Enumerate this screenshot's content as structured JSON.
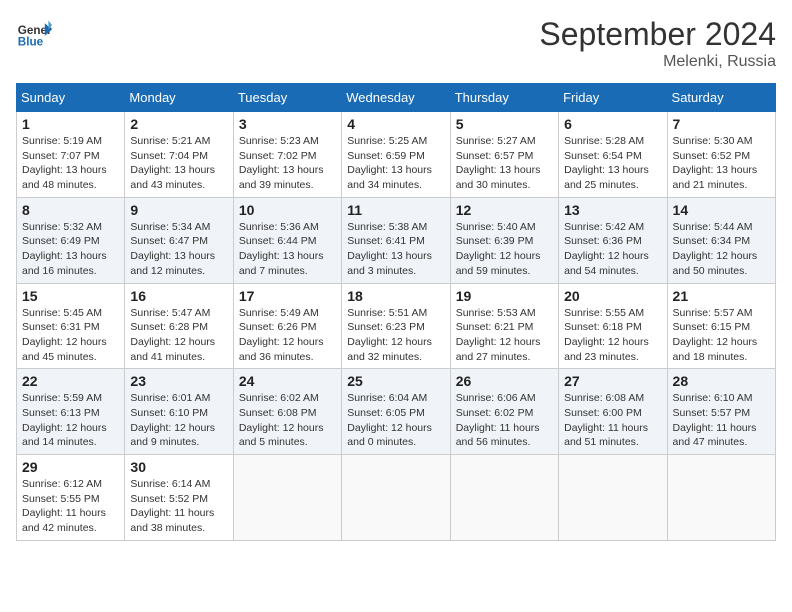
{
  "header": {
    "logo_line1": "General",
    "logo_line2": "Blue",
    "month": "September 2024",
    "location": "Melenki, Russia"
  },
  "weekdays": [
    "Sunday",
    "Monday",
    "Tuesday",
    "Wednesday",
    "Thursday",
    "Friday",
    "Saturday"
  ],
  "weeks": [
    [
      {
        "day": "1",
        "info": "Sunrise: 5:19 AM\nSunset: 7:07 PM\nDaylight: 13 hours\nand 48 minutes."
      },
      {
        "day": "2",
        "info": "Sunrise: 5:21 AM\nSunset: 7:04 PM\nDaylight: 13 hours\nand 43 minutes."
      },
      {
        "day": "3",
        "info": "Sunrise: 5:23 AM\nSunset: 7:02 PM\nDaylight: 13 hours\nand 39 minutes."
      },
      {
        "day": "4",
        "info": "Sunrise: 5:25 AM\nSunset: 6:59 PM\nDaylight: 13 hours\nand 34 minutes."
      },
      {
        "day": "5",
        "info": "Sunrise: 5:27 AM\nSunset: 6:57 PM\nDaylight: 13 hours\nand 30 minutes."
      },
      {
        "day": "6",
        "info": "Sunrise: 5:28 AM\nSunset: 6:54 PM\nDaylight: 13 hours\nand 25 minutes."
      },
      {
        "day": "7",
        "info": "Sunrise: 5:30 AM\nSunset: 6:52 PM\nDaylight: 13 hours\nand 21 minutes."
      }
    ],
    [
      {
        "day": "8",
        "info": "Sunrise: 5:32 AM\nSunset: 6:49 PM\nDaylight: 13 hours\nand 16 minutes."
      },
      {
        "day": "9",
        "info": "Sunrise: 5:34 AM\nSunset: 6:47 PM\nDaylight: 13 hours\nand 12 minutes."
      },
      {
        "day": "10",
        "info": "Sunrise: 5:36 AM\nSunset: 6:44 PM\nDaylight: 13 hours\nand 7 minutes."
      },
      {
        "day": "11",
        "info": "Sunrise: 5:38 AM\nSunset: 6:41 PM\nDaylight: 13 hours\nand 3 minutes."
      },
      {
        "day": "12",
        "info": "Sunrise: 5:40 AM\nSunset: 6:39 PM\nDaylight: 12 hours\nand 59 minutes."
      },
      {
        "day": "13",
        "info": "Sunrise: 5:42 AM\nSunset: 6:36 PM\nDaylight: 12 hours\nand 54 minutes."
      },
      {
        "day": "14",
        "info": "Sunrise: 5:44 AM\nSunset: 6:34 PM\nDaylight: 12 hours\nand 50 minutes."
      }
    ],
    [
      {
        "day": "15",
        "info": "Sunrise: 5:45 AM\nSunset: 6:31 PM\nDaylight: 12 hours\nand 45 minutes."
      },
      {
        "day": "16",
        "info": "Sunrise: 5:47 AM\nSunset: 6:28 PM\nDaylight: 12 hours\nand 41 minutes."
      },
      {
        "day": "17",
        "info": "Sunrise: 5:49 AM\nSunset: 6:26 PM\nDaylight: 12 hours\nand 36 minutes."
      },
      {
        "day": "18",
        "info": "Sunrise: 5:51 AM\nSunset: 6:23 PM\nDaylight: 12 hours\nand 32 minutes."
      },
      {
        "day": "19",
        "info": "Sunrise: 5:53 AM\nSunset: 6:21 PM\nDaylight: 12 hours\nand 27 minutes."
      },
      {
        "day": "20",
        "info": "Sunrise: 5:55 AM\nSunset: 6:18 PM\nDaylight: 12 hours\nand 23 minutes."
      },
      {
        "day": "21",
        "info": "Sunrise: 5:57 AM\nSunset: 6:15 PM\nDaylight: 12 hours\nand 18 minutes."
      }
    ],
    [
      {
        "day": "22",
        "info": "Sunrise: 5:59 AM\nSunset: 6:13 PM\nDaylight: 12 hours\nand 14 minutes."
      },
      {
        "day": "23",
        "info": "Sunrise: 6:01 AM\nSunset: 6:10 PM\nDaylight: 12 hours\nand 9 minutes."
      },
      {
        "day": "24",
        "info": "Sunrise: 6:02 AM\nSunset: 6:08 PM\nDaylight: 12 hours\nand 5 minutes."
      },
      {
        "day": "25",
        "info": "Sunrise: 6:04 AM\nSunset: 6:05 PM\nDaylight: 12 hours\nand 0 minutes."
      },
      {
        "day": "26",
        "info": "Sunrise: 6:06 AM\nSunset: 6:02 PM\nDaylight: 11 hours\nand 56 minutes."
      },
      {
        "day": "27",
        "info": "Sunrise: 6:08 AM\nSunset: 6:00 PM\nDaylight: 11 hours\nand 51 minutes."
      },
      {
        "day": "28",
        "info": "Sunrise: 6:10 AM\nSunset: 5:57 PM\nDaylight: 11 hours\nand 47 minutes."
      }
    ],
    [
      {
        "day": "29",
        "info": "Sunrise: 6:12 AM\nSunset: 5:55 PM\nDaylight: 11 hours\nand 42 minutes."
      },
      {
        "day": "30",
        "info": "Sunrise: 6:14 AM\nSunset: 5:52 PM\nDaylight: 11 hours\nand 38 minutes."
      },
      {
        "day": "",
        "info": ""
      },
      {
        "day": "",
        "info": ""
      },
      {
        "day": "",
        "info": ""
      },
      {
        "day": "",
        "info": ""
      },
      {
        "day": "",
        "info": ""
      }
    ]
  ]
}
